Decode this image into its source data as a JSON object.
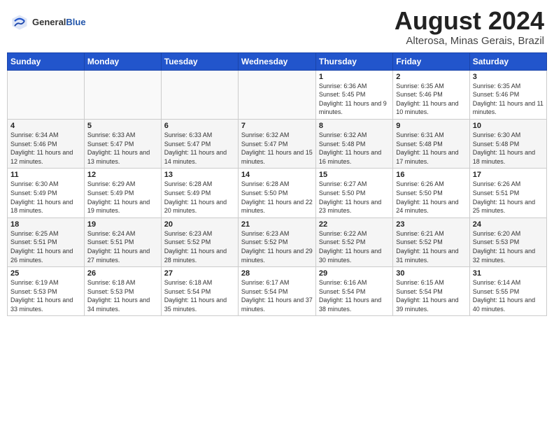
{
  "header": {
    "logo_general": "General",
    "logo_blue": "Blue",
    "month_year": "August 2024",
    "location": "Alterosa, Minas Gerais, Brazil"
  },
  "days_of_week": [
    "Sunday",
    "Monday",
    "Tuesday",
    "Wednesday",
    "Thursday",
    "Friday",
    "Saturday"
  ],
  "weeks": [
    [
      {
        "day": "",
        "info": ""
      },
      {
        "day": "",
        "info": ""
      },
      {
        "day": "",
        "info": ""
      },
      {
        "day": "",
        "info": ""
      },
      {
        "day": "1",
        "info": "Sunrise: 6:36 AM\nSunset: 5:45 PM\nDaylight: 11 hours and 9 minutes."
      },
      {
        "day": "2",
        "info": "Sunrise: 6:35 AM\nSunset: 5:46 PM\nDaylight: 11 hours and 10 minutes."
      },
      {
        "day": "3",
        "info": "Sunrise: 6:35 AM\nSunset: 5:46 PM\nDaylight: 11 hours and 11 minutes."
      }
    ],
    [
      {
        "day": "4",
        "info": "Sunrise: 6:34 AM\nSunset: 5:46 PM\nDaylight: 11 hours and 12 minutes."
      },
      {
        "day": "5",
        "info": "Sunrise: 6:33 AM\nSunset: 5:47 PM\nDaylight: 11 hours and 13 minutes."
      },
      {
        "day": "6",
        "info": "Sunrise: 6:33 AM\nSunset: 5:47 PM\nDaylight: 11 hours and 14 minutes."
      },
      {
        "day": "7",
        "info": "Sunrise: 6:32 AM\nSunset: 5:47 PM\nDaylight: 11 hours and 15 minutes."
      },
      {
        "day": "8",
        "info": "Sunrise: 6:32 AM\nSunset: 5:48 PM\nDaylight: 11 hours and 16 minutes."
      },
      {
        "day": "9",
        "info": "Sunrise: 6:31 AM\nSunset: 5:48 PM\nDaylight: 11 hours and 17 minutes."
      },
      {
        "day": "10",
        "info": "Sunrise: 6:30 AM\nSunset: 5:48 PM\nDaylight: 11 hours and 18 minutes."
      }
    ],
    [
      {
        "day": "11",
        "info": "Sunrise: 6:30 AM\nSunset: 5:49 PM\nDaylight: 11 hours and 18 minutes."
      },
      {
        "day": "12",
        "info": "Sunrise: 6:29 AM\nSunset: 5:49 PM\nDaylight: 11 hours and 19 minutes."
      },
      {
        "day": "13",
        "info": "Sunrise: 6:28 AM\nSunset: 5:49 PM\nDaylight: 11 hours and 20 minutes."
      },
      {
        "day": "14",
        "info": "Sunrise: 6:28 AM\nSunset: 5:50 PM\nDaylight: 11 hours and 22 minutes."
      },
      {
        "day": "15",
        "info": "Sunrise: 6:27 AM\nSunset: 5:50 PM\nDaylight: 11 hours and 23 minutes."
      },
      {
        "day": "16",
        "info": "Sunrise: 6:26 AM\nSunset: 5:50 PM\nDaylight: 11 hours and 24 minutes."
      },
      {
        "day": "17",
        "info": "Sunrise: 6:26 AM\nSunset: 5:51 PM\nDaylight: 11 hours and 25 minutes."
      }
    ],
    [
      {
        "day": "18",
        "info": "Sunrise: 6:25 AM\nSunset: 5:51 PM\nDaylight: 11 hours and 26 minutes."
      },
      {
        "day": "19",
        "info": "Sunrise: 6:24 AM\nSunset: 5:51 PM\nDaylight: 11 hours and 27 minutes."
      },
      {
        "day": "20",
        "info": "Sunrise: 6:23 AM\nSunset: 5:52 PM\nDaylight: 11 hours and 28 minutes."
      },
      {
        "day": "21",
        "info": "Sunrise: 6:23 AM\nSunset: 5:52 PM\nDaylight: 11 hours and 29 minutes."
      },
      {
        "day": "22",
        "info": "Sunrise: 6:22 AM\nSunset: 5:52 PM\nDaylight: 11 hours and 30 minutes."
      },
      {
        "day": "23",
        "info": "Sunrise: 6:21 AM\nSunset: 5:52 PM\nDaylight: 11 hours and 31 minutes."
      },
      {
        "day": "24",
        "info": "Sunrise: 6:20 AM\nSunset: 5:53 PM\nDaylight: 11 hours and 32 minutes."
      }
    ],
    [
      {
        "day": "25",
        "info": "Sunrise: 6:19 AM\nSunset: 5:53 PM\nDaylight: 11 hours and 33 minutes."
      },
      {
        "day": "26",
        "info": "Sunrise: 6:18 AM\nSunset: 5:53 PM\nDaylight: 11 hours and 34 minutes."
      },
      {
        "day": "27",
        "info": "Sunrise: 6:18 AM\nSunset: 5:54 PM\nDaylight: 11 hours and 35 minutes."
      },
      {
        "day": "28",
        "info": "Sunrise: 6:17 AM\nSunset: 5:54 PM\nDaylight: 11 hours and 37 minutes."
      },
      {
        "day": "29",
        "info": "Sunrise: 6:16 AM\nSunset: 5:54 PM\nDaylight: 11 hours and 38 minutes."
      },
      {
        "day": "30",
        "info": "Sunrise: 6:15 AM\nSunset: 5:54 PM\nDaylight: 11 hours and 39 minutes."
      },
      {
        "day": "31",
        "info": "Sunrise: 6:14 AM\nSunset: 5:55 PM\nDaylight: 11 hours and 40 minutes."
      }
    ]
  ]
}
